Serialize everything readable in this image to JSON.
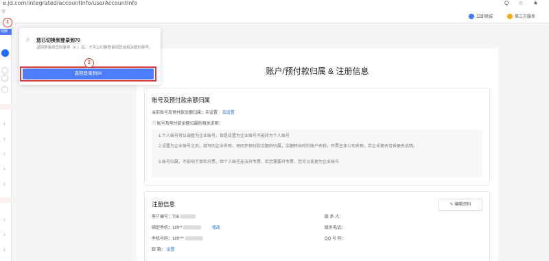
{
  "browser": {
    "url": "e.jd.com/integrated/accountInfo/userAccountInfo",
    "icons": "Q ☆ ★"
  },
  "topbar": {
    "left_text": "字",
    "links": [
      {
        "label": "立即商城",
        "color": "#3a7afe"
      },
      {
        "label": "第三方服务",
        "color": "#f3a91a"
      }
    ]
  },
  "sidebar": {
    "switch_tag": "切换 ≫"
  },
  "popup": {
    "title": "您已切换到登录到70",
    "desc": "返回登录到您的事务（6          ）后，才可以切换登录到其他相关联的账号。",
    "button_label": "返回登录到66"
  },
  "badges": [
    "1",
    "2"
  ],
  "page": {
    "title": "账户/预付款归属 & 注册信息"
  },
  "account_section": {
    "title": "账号及预付款余额归属",
    "current_label": "当前账号及预付款余额归属：未设置",
    "set_link": "去设置",
    "notes_title": "ⓘ 账号及预付款余额归属的相关说明：",
    "notes": [
      "1.个人账号可以调整为企业账号，但是设置为企业账号不能转为个人账号",
      "2.设置为企业账号之后，填写的企业名称，将同步预付款余额的归属，余额转出时的账户名称，开票主体公司名称，若企业更名可去更名说明。",
      "3.账号归属，不影响下单和开票，但个人账号无法开专票，若您需要开专票，您可以变更为企业账号"
    ]
  },
  "register_section": {
    "title": "注册信息",
    "edit_label": "编辑资料",
    "edit_icon": "✎",
    "fields": [
      {
        "label": "客户编号：706",
        "value": ""
      },
      {
        "label": "绑定手机：189**",
        "value": "修改"
      },
      {
        "label": "手机号码：189***",
        "value": ""
      },
      {
        "label": "邮      箱：",
        "value": "设置"
      }
    ],
    "right_fields": [
      {
        "label": "联  系  人："
      },
      {
        "label": "联系电话："
      },
      {
        "label": "QQ 号 码："
      }
    ]
  }
}
